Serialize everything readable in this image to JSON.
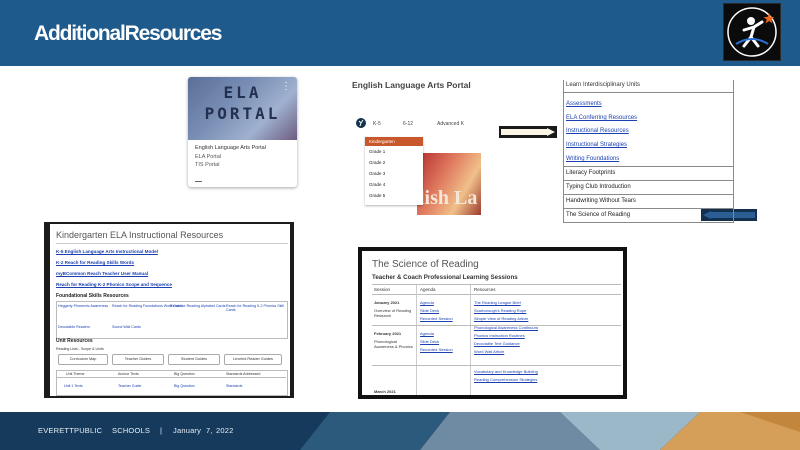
{
  "header": {
    "title": "AdditionalResources"
  },
  "footer": {
    "org1": "EVERETTPUBLIC",
    "org2": "SCHOOLS",
    "sep": "|",
    "month": "January",
    "day": "7,",
    "year": "2022"
  },
  "card": {
    "image_text_1": "ELA",
    "image_text_2": "PORTAL",
    "menu": "⋮",
    "title": "English Language Arts Portal",
    "subtitle": "ELA Portal",
    "meta": "TIS Portal"
  },
  "portal": {
    "title": "English Language Arts Portal",
    "nav": [
      "K-5",
      "6-12",
      "Advanced K"
    ],
    "dropdown_head": "Kindergarten",
    "dropdown_items": [
      "Grade 1",
      "Grade 2",
      "Grade 3",
      "Grade 4",
      "Grade 5"
    ],
    "hero_text": "lish La"
  },
  "right_list": {
    "top_partial": "Learn Interdisciplinary Units",
    "items": [
      {
        "label": "Assessments",
        "link": true
      },
      {
        "label": "ELA Conferring Resources",
        "link": true
      },
      {
        "label": "Instructional Resources",
        "link": true
      },
      {
        "label": "Instructional Strategies",
        "link": true
      },
      {
        "label": "Writing Foundations",
        "link": true
      },
      {
        "label": "Literacy Footprints",
        "link": false
      },
      {
        "label": "Typing Club Introduction",
        "link": false
      },
      {
        "label": "Handwriting Without Tears",
        "link": false
      },
      {
        "label": "The Science of Reading",
        "link": false
      }
    ]
  },
  "kinder": {
    "title": "Kindergarten ELA Instructional Resources",
    "links": [
      "K-5 English Language Arts Instructional Model",
      "K-2 Reach for Reading Skills Words",
      "myBCommon Reach Teacher User Manual",
      "Reach for Reading K-2 Phonics Scope and Sequence"
    ],
    "foundational_head": "Foundational Skills Resources",
    "fs_cells": [
      "Heggerty Phonemic Awareness",
      "Reach for Reading Foundations Word Cards",
      "Reach for Reading Alphabet Cards",
      "Reach for Reading K-2 Phonics Skill Cards",
      "Decodable Readers",
      "Sound Wall Cards"
    ],
    "unit_head": "Unit Resources",
    "unit_sub": "Reading Lists - Scope & Units",
    "pills": [
      "Curriculum Map",
      "Teacher Guides",
      "Student Guides",
      "Leveled Reader Guides"
    ],
    "table_headers": [
      "Unit Theme",
      "Anchor Texts",
      "Big Question",
      "Standards Addressed"
    ],
    "table_row": [
      "Unit 1 Texts",
      "Teacher Guide",
      "Big Question",
      "Standards"
    ]
  },
  "science": {
    "title": "The Science of Reading",
    "subtitle": "Teacher & Coach Professional Learning Sessions",
    "headers": [
      "Session",
      "Agenda",
      "Resources"
    ],
    "rows": [
      {
        "session": "January 2021",
        "session_sub": "Overview of Reading Research",
        "agenda": [
          "Agenda",
          "Slide Deck",
          "Recorded Session"
        ],
        "resources": [
          "The Reading League Brief",
          "Scarborough's Reading Rope",
          "Simple View of Reading Article"
        ]
      },
      {
        "session": "February 2021",
        "session_sub": "Phonological Awareness & Phonics",
        "agenda": [
          "Agenda",
          "Slide Deck",
          "Recorded Session"
        ],
        "resources": [
          "Phonological Awareness Continuum",
          "Phonics Instruction Routines",
          "Decodable Text Guidance",
          "Word Wall Article"
        ]
      },
      {
        "session": "March 2021",
        "session_sub": "",
        "agenda": [],
        "resources": [
          "Vocabulary and Knowledge Building",
          "Reading Comprehension Strategies"
        ]
      }
    ]
  },
  "colors": {
    "header": "#1f5a8d",
    "link": "#1a3fae",
    "accent": "#c8582c"
  }
}
